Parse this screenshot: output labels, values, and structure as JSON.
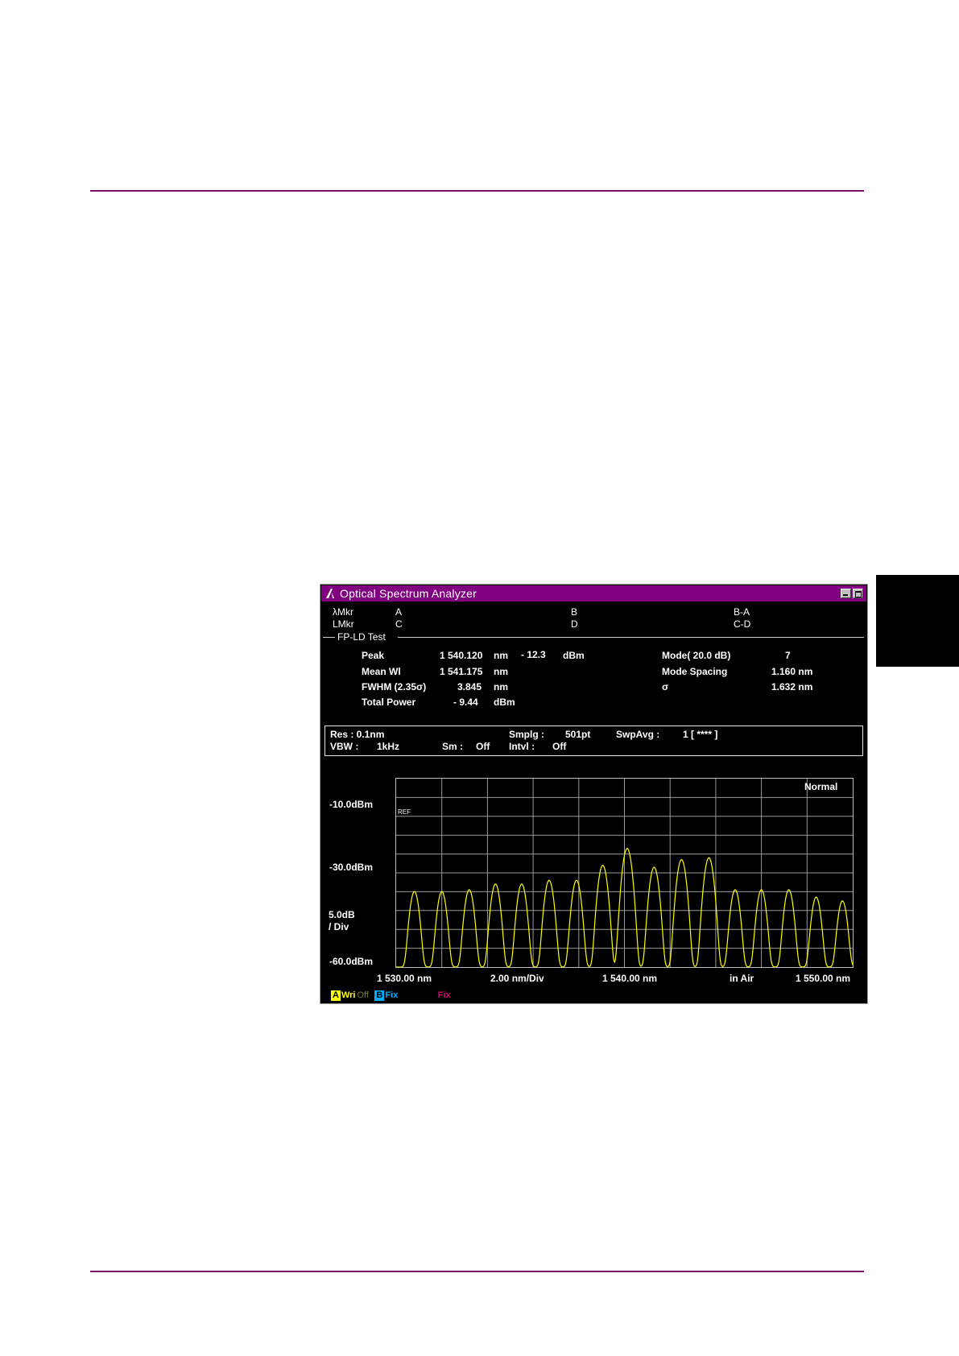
{
  "window": {
    "title": "Optical Spectrum Analyzer",
    "min_icon": "minimize-icon",
    "max_icon": "maximize-icon"
  },
  "markers": {
    "row1": {
      "label": "λMkr",
      "a": "A",
      "b": "B",
      "ba": "B-A"
    },
    "row2": {
      "label": "LMkr",
      "a": "C",
      "b": "D",
      "ba": "C-D"
    }
  },
  "section": {
    "title": "FP-LD Test"
  },
  "results": {
    "peak": {
      "label": "Peak",
      "value": "1 540.120",
      "unit": "nm",
      "power": "-  12.3",
      "power_unit": "dBm"
    },
    "mean": {
      "label": "Mean Wl",
      "value": "1 541.175",
      "unit": "nm"
    },
    "fwhm": {
      "label": "FWHM (2.35σ)",
      "value": "3.845",
      "unit": "nm"
    },
    "total": {
      "label": "Total Power",
      "value": "-  9.44",
      "unit": "dBm"
    },
    "mode": {
      "label": "Mode(   20.0  dB)",
      "value": "7"
    },
    "spacing": {
      "label": "Mode Spacing",
      "value": "1.160 nm"
    },
    "sigma": {
      "label": "σ",
      "value": "1.632 nm"
    }
  },
  "settings": {
    "res": "Res :  0.1nm",
    "smplg_label": "Smplg :",
    "smplg_value": "501pt",
    "swpavg_label": "SwpAvg :",
    "swpavg_value": "1  [       ****  ]",
    "vbw_label": "VBW :",
    "vbw_value": "1kHz",
    "sm_label": "Sm :",
    "sm_value": "Off",
    "intvl_label": "Intvl :",
    "intvl_value": "Off"
  },
  "axis": {
    "ref_level": "-10.0dBm",
    "mid_level": "-30.0dBm",
    "scale": "5.0dB",
    "scale_unit": "/ Div",
    "bottom_level": "-60.0dBm",
    "x_start": "1 530.00 nm",
    "x_div": "2.00 nm/Div",
    "x_center": "1 540.00 nm",
    "medium": "in Air",
    "x_stop": "1 550.00 nm",
    "mode": "Normal",
    "ref_tag": "REF"
  },
  "traces": {
    "a_letter": "A",
    "a_mode": "Wri",
    "a_extra": "Off",
    "b_letter": "B",
    "b_mode": "Fix",
    "c_mode": "Fix",
    "color_a": "#ffff00",
    "color_b": "#00b0ff",
    "color_c": "#e0007a"
  },
  "chart_data": {
    "type": "line",
    "xlabel": "",
    "ylabel": "",
    "xlim": [
      1530.0,
      1550.0
    ],
    "ylim": [
      -60.0,
      -10.0
    ],
    "series": [
      {
        "color": "#ffff00",
        "peaks_x": [
          1530.8,
          1532.0,
          1533.2,
          1534.35,
          1535.5,
          1536.7,
          1537.9,
          1539.05,
          1540.12,
          1541.3,
          1542.5,
          1543.7,
          1544.85,
          1546.0,
          1547.2,
          1548.4,
          1549.55
        ],
        "peaks_y": [
          -40.0,
          -40.0,
          -39.5,
          -38.0,
          -38.0,
          -37.0,
          -37.0,
          -33.0,
          -28.5,
          -33.5,
          -31.5,
          -31.0,
          -39.5,
          -39.5,
          -39.5,
          -41.5,
          -42.5
        ],
        "floor": -60.0
      }
    ]
  }
}
